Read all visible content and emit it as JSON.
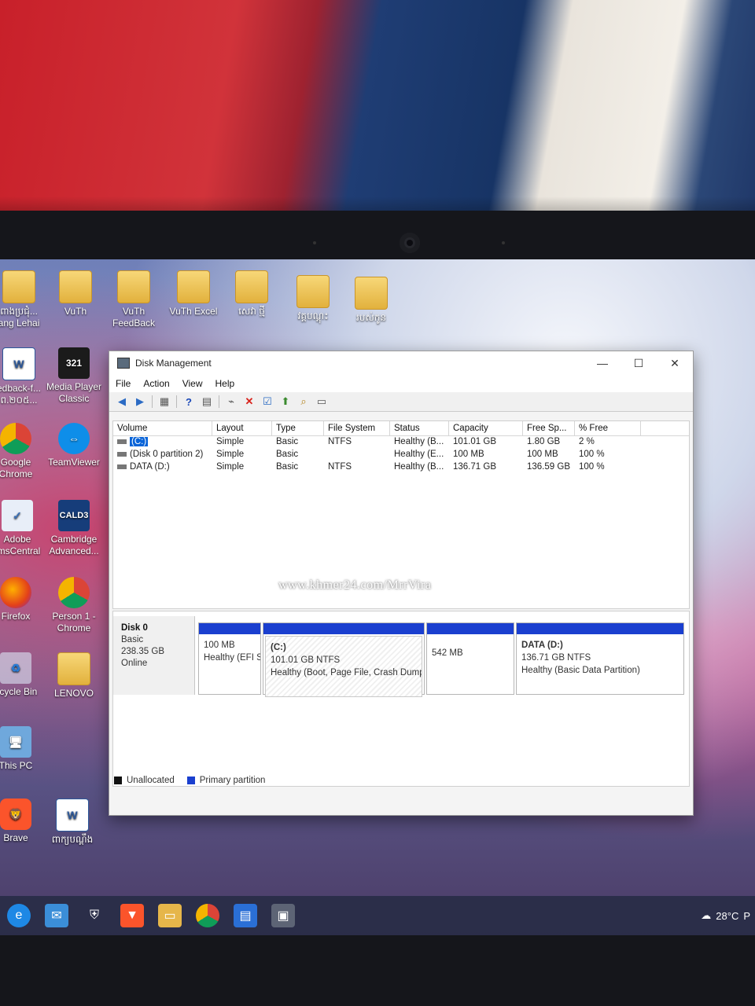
{
  "window": {
    "title": "Disk Management",
    "controls": {
      "minimize": "—",
      "maximize": "☐",
      "close": "✕"
    }
  },
  "menu": [
    "File",
    "Action",
    "View",
    "Help"
  ],
  "volumes": {
    "columns": [
      "Volume",
      "Layout",
      "Type",
      "File System",
      "Status",
      "Capacity",
      "Free Sp...",
      "% Free"
    ],
    "rows": [
      [
        "(C:)",
        "Simple",
        "Basic",
        "NTFS",
        "Healthy (B...",
        "101.01 GB",
        "1.80 GB",
        "2 %"
      ],
      [
        "(Disk 0 partition 2)",
        "Simple",
        "Basic",
        "",
        "Healthy (E...",
        "100 MB",
        "100 MB",
        "100 %"
      ],
      [
        "DATA (D:)",
        "Simple",
        "Basic",
        "NTFS",
        "Healthy (B...",
        "136.71 GB",
        "136.59 GB",
        "100 %"
      ]
    ]
  },
  "watermark": "www.khmer24.com/MrrVira",
  "disk": {
    "name": "Disk 0",
    "type": "Basic",
    "size": "238.35 GB",
    "status": "Online",
    "partitions": [
      {
        "name": "",
        "size": "100 MB",
        "status": "Healthy (EFI S"
      },
      {
        "name": "(C:)",
        "size": "101.01 GB NTFS",
        "status": "Healthy (Boot, Page File, Crash Dump"
      },
      {
        "name": "",
        "size": "542 MB",
        "status": ""
      },
      {
        "name": "DATA  (D:)",
        "size": "136.71 GB NTFS",
        "status": "Healthy (Basic Data Partition)"
      }
    ]
  },
  "legend": {
    "unallocated": "Unallocated",
    "primary": "Primary partition"
  },
  "colors": {
    "primary_partition": "#1a3fcf",
    "unallocated": "#111111"
  },
  "desktop_icons": [
    {
      "label": "ពាងប្រជុំ...\nang Lehai",
      "icon": "folder-icon"
    },
    {
      "label": "VuTh",
      "icon": "folder-icon"
    },
    {
      "label": "VuTh\nFeedBack",
      "icon": "folder-icon"
    },
    {
      "label": "VuTh Excel",
      "icon": "folder-icon"
    },
    {
      "label": "សេវា ថ្មី",
      "icon": "folder-icon"
    },
    {
      "label": "វគ្គបណ្ដុះ",
      "icon": "folder-icon"
    },
    {
      "label": "របស់កូន",
      "icon": "folder-icon"
    },
    {
      "label": "edback-f...\nព.២០៥...",
      "icon": "word-icon"
    },
    {
      "label": "Media Player\nClassic",
      "icon": "media-player-icon"
    },
    {
      "label": "Google\nChrome",
      "icon": "chrome-icon"
    },
    {
      "label": "TeamViewer",
      "icon": "teamviewer-icon"
    },
    {
      "label": "Adobe\nrmsCentral",
      "icon": "adobe-icon"
    },
    {
      "label": "Cambridge\nAdvanced...",
      "icon": "cambridge-icon"
    },
    {
      "label": "Firefox",
      "icon": "firefox-icon"
    },
    {
      "label": "Person 1 -\nChrome",
      "icon": "chrome-icon"
    },
    {
      "label": "ecycle Bin",
      "icon": "recycle-bin-icon"
    },
    {
      "label": "LENOVO",
      "icon": "user-folder-icon"
    },
    {
      "label": "This PC",
      "icon": "computer-icon"
    },
    {
      "label": "Brave",
      "icon": "brave-icon"
    },
    {
      "label": "ពាក្យបណ្តឹង",
      "icon": "word-icon"
    }
  ],
  "tray": {
    "temperature": "28°C",
    "trail": "P"
  }
}
